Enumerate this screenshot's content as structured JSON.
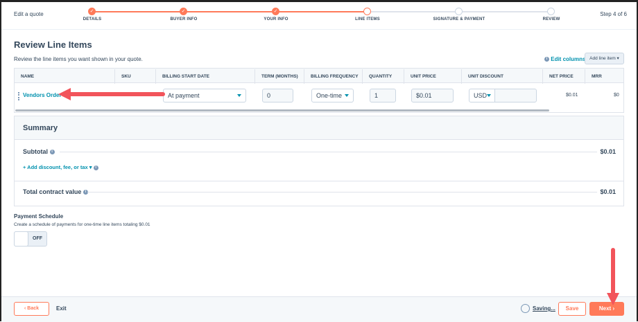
{
  "header": {
    "title": "Edit a quote",
    "step_text": "Step 4 of 6",
    "steps": [
      {
        "label": "DETAILS",
        "state": "done"
      },
      {
        "label": "BUYER INFO",
        "state": "done"
      },
      {
        "label": "YOUR INFO",
        "state": "done"
      },
      {
        "label": "LINE ITEMS",
        "state": "current"
      },
      {
        "label": "SIGNATURE & PAYMENT",
        "state": "todo"
      },
      {
        "label": "REVIEW",
        "state": "todo"
      }
    ]
  },
  "section": {
    "title": "Review Line Items",
    "subtitle": "Review the line items you want shown in your quote.",
    "edit_columns": "Edit columns",
    "add_line_item": "Add line item ▾"
  },
  "table": {
    "columns": [
      "NAME",
      "SKU",
      "BILLING START DATE",
      "TERM (MONTHS)",
      "BILLING FREQUENCY",
      "QUANTITY",
      "UNIT PRICE",
      "UNIT DISCOUNT",
      "NET PRICE",
      "MRR"
    ],
    "row": {
      "name": "Vendors Order",
      "billing_start": "At payment",
      "term": "0",
      "frequency": "One-time",
      "quantity": "1",
      "unit_price": "$0.01",
      "currency": "USD",
      "discount": "",
      "net_price": "$0.01",
      "mrr": "$0"
    }
  },
  "summary": {
    "title": "Summary",
    "subtotal_label": "Subtotal",
    "subtotal": "$0.01",
    "add_discount": "+ Add discount, fee, or tax ▾",
    "total_label": "Total contract value",
    "total": "$0.01"
  },
  "payment": {
    "title": "Payment Schedule",
    "desc": "Create a schedule of payments for one-time line items totaling $0.01",
    "toggle": "OFF"
  },
  "footer": {
    "back": "‹  Back",
    "exit": "Exit",
    "saving": "Saving...",
    "save": "Save",
    "next": "Next  ›"
  },
  "colors": {
    "accent": "#ff7a59",
    "link": "#0091ae",
    "annotation": "#f2545b"
  }
}
